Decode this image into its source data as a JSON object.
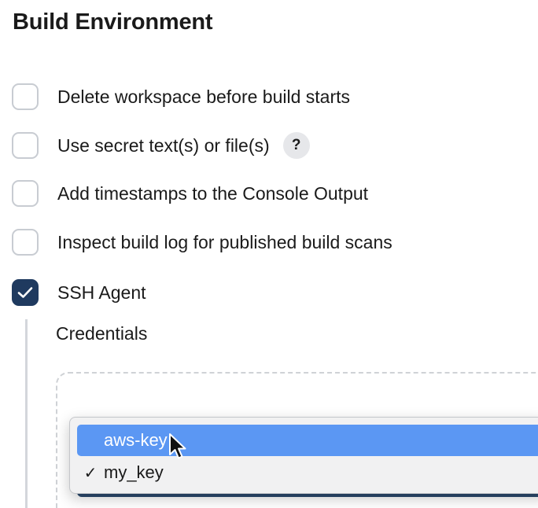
{
  "section": {
    "title": "Build Environment"
  },
  "options": [
    {
      "label": "Delete workspace before build starts",
      "checked": false
    },
    {
      "label": "Use secret text(s) or file(s)",
      "checked": false,
      "help": "?"
    },
    {
      "label": "Add timestamps to the Console Output",
      "checked": false
    },
    {
      "label": "Inspect build log for published build scans",
      "checked": false
    },
    {
      "label": "SSH Agent",
      "checked": true
    }
  ],
  "ssh_agent": {
    "credentials_label": "Credentials",
    "dropdown": {
      "items": [
        {
          "label": "aws-key",
          "highlighted": true,
          "selected": false
        },
        {
          "label": "my_key",
          "highlighted": false,
          "selected": true,
          "check": "✓"
        }
      ]
    }
  },
  "colors": {
    "checkbox_checked": "#1f3a5f",
    "highlight": "#5b97f3"
  },
  "icons": {
    "checkmark": "checkmark-icon",
    "cursor": "mouse-cursor-icon"
  }
}
